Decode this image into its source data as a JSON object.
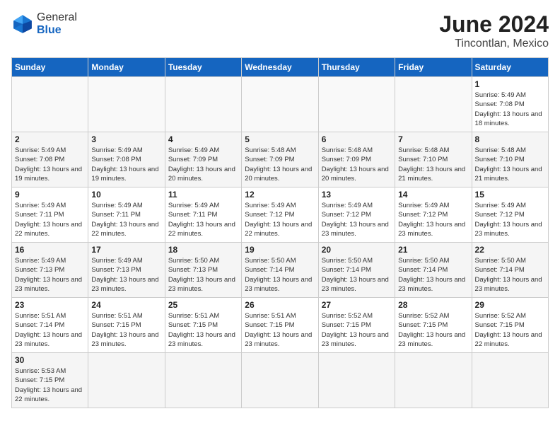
{
  "header": {
    "logo_general": "General",
    "logo_blue": "Blue",
    "title": "June 2024",
    "subtitle": "Tincontlan, Mexico"
  },
  "days_of_week": [
    "Sunday",
    "Monday",
    "Tuesday",
    "Wednesday",
    "Thursday",
    "Friday",
    "Saturday"
  ],
  "weeks": [
    [
      {
        "day": "",
        "info": ""
      },
      {
        "day": "",
        "info": ""
      },
      {
        "day": "",
        "info": ""
      },
      {
        "day": "",
        "info": ""
      },
      {
        "day": "",
        "info": ""
      },
      {
        "day": "",
        "info": ""
      },
      {
        "day": "1",
        "info": "Sunrise: 5:49 AM\nSunset: 7:08 PM\nDaylight: 13 hours and 18 minutes."
      }
    ],
    [
      {
        "day": "2",
        "info": "Sunrise: 5:49 AM\nSunset: 7:08 PM\nDaylight: 13 hours and 19 minutes."
      },
      {
        "day": "3",
        "info": "Sunrise: 5:49 AM\nSunset: 7:08 PM\nDaylight: 13 hours and 19 minutes."
      },
      {
        "day": "4",
        "info": "Sunrise: 5:49 AM\nSunset: 7:09 PM\nDaylight: 13 hours and 20 minutes."
      },
      {
        "day": "5",
        "info": "Sunrise: 5:48 AM\nSunset: 7:09 PM\nDaylight: 13 hours and 20 minutes."
      },
      {
        "day": "6",
        "info": "Sunrise: 5:48 AM\nSunset: 7:09 PM\nDaylight: 13 hours and 20 minutes."
      },
      {
        "day": "7",
        "info": "Sunrise: 5:48 AM\nSunset: 7:10 PM\nDaylight: 13 hours and 21 minutes."
      },
      {
        "day": "8",
        "info": "Sunrise: 5:48 AM\nSunset: 7:10 PM\nDaylight: 13 hours and 21 minutes."
      }
    ],
    [
      {
        "day": "9",
        "info": "Sunrise: 5:49 AM\nSunset: 7:11 PM\nDaylight: 13 hours and 22 minutes."
      },
      {
        "day": "10",
        "info": "Sunrise: 5:49 AM\nSunset: 7:11 PM\nDaylight: 13 hours and 22 minutes."
      },
      {
        "day": "11",
        "info": "Sunrise: 5:49 AM\nSunset: 7:11 PM\nDaylight: 13 hours and 22 minutes."
      },
      {
        "day": "12",
        "info": "Sunrise: 5:49 AM\nSunset: 7:12 PM\nDaylight: 13 hours and 22 minutes."
      },
      {
        "day": "13",
        "info": "Sunrise: 5:49 AM\nSunset: 7:12 PM\nDaylight: 13 hours and 23 minutes."
      },
      {
        "day": "14",
        "info": "Sunrise: 5:49 AM\nSunset: 7:12 PM\nDaylight: 13 hours and 23 minutes."
      },
      {
        "day": "15",
        "info": "Sunrise: 5:49 AM\nSunset: 7:12 PM\nDaylight: 13 hours and 23 minutes."
      }
    ],
    [
      {
        "day": "16",
        "info": "Sunrise: 5:49 AM\nSunset: 7:13 PM\nDaylight: 13 hours and 23 minutes."
      },
      {
        "day": "17",
        "info": "Sunrise: 5:49 AM\nSunset: 7:13 PM\nDaylight: 13 hours and 23 minutes."
      },
      {
        "day": "18",
        "info": "Sunrise: 5:50 AM\nSunset: 7:13 PM\nDaylight: 13 hours and 23 minutes."
      },
      {
        "day": "19",
        "info": "Sunrise: 5:50 AM\nSunset: 7:14 PM\nDaylight: 13 hours and 23 minutes."
      },
      {
        "day": "20",
        "info": "Sunrise: 5:50 AM\nSunset: 7:14 PM\nDaylight: 13 hours and 23 minutes."
      },
      {
        "day": "21",
        "info": "Sunrise: 5:50 AM\nSunset: 7:14 PM\nDaylight: 13 hours and 23 minutes."
      },
      {
        "day": "22",
        "info": "Sunrise: 5:50 AM\nSunset: 7:14 PM\nDaylight: 13 hours and 23 minutes."
      }
    ],
    [
      {
        "day": "23",
        "info": "Sunrise: 5:51 AM\nSunset: 7:14 PM\nDaylight: 13 hours and 23 minutes."
      },
      {
        "day": "24",
        "info": "Sunrise: 5:51 AM\nSunset: 7:15 PM\nDaylight: 13 hours and 23 minutes."
      },
      {
        "day": "25",
        "info": "Sunrise: 5:51 AM\nSunset: 7:15 PM\nDaylight: 13 hours and 23 minutes."
      },
      {
        "day": "26",
        "info": "Sunrise: 5:51 AM\nSunset: 7:15 PM\nDaylight: 13 hours and 23 minutes."
      },
      {
        "day": "27",
        "info": "Sunrise: 5:52 AM\nSunset: 7:15 PM\nDaylight: 13 hours and 23 minutes."
      },
      {
        "day": "28",
        "info": "Sunrise: 5:52 AM\nSunset: 7:15 PM\nDaylight: 13 hours and 23 minutes."
      },
      {
        "day": "29",
        "info": "Sunrise: 5:52 AM\nSunset: 7:15 PM\nDaylight: 13 hours and 22 minutes."
      }
    ],
    [
      {
        "day": "30",
        "info": "Sunrise: 5:53 AM\nSunset: 7:15 PM\nDaylight: 13 hours and 22 minutes."
      },
      {
        "day": "",
        "info": ""
      },
      {
        "day": "",
        "info": ""
      },
      {
        "day": "",
        "info": ""
      },
      {
        "day": "",
        "info": ""
      },
      {
        "day": "",
        "info": ""
      },
      {
        "day": "",
        "info": ""
      }
    ]
  ]
}
